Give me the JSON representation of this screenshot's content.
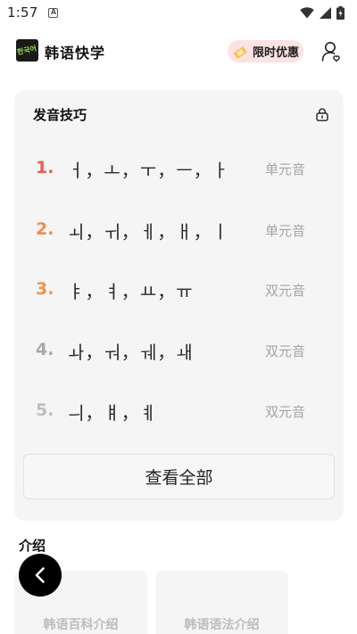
{
  "status_bar": {
    "time": "1:57",
    "app_icon_letter": "A"
  },
  "header": {
    "logo_text": "한국어",
    "app_title": "韩语快学",
    "promo_label": "限时优惠"
  },
  "pronunciation_card": {
    "title": "发音技巧",
    "rows": [
      {
        "number": "1.",
        "letters": "ㅓ，ㅗ，ㅜ，ㅡ，ㅏ",
        "tag": "单元音",
        "number_color": "#ee5a52"
      },
      {
        "number": "2.",
        "letters": "ㅚ，ㅟ，ㅔ，ㅐ，ㅣ",
        "tag": "单元音",
        "number_color": "#f28a4c"
      },
      {
        "number": "3.",
        "letters": "ㅑ，ㅕ，ㅛ，ㅠ",
        "tag": "双元音",
        "number_color": "#f2924e"
      },
      {
        "number": "4.",
        "letters": "ㅘ，ㅝ，ㅞ，ㅙ",
        "tag": "双元音",
        "number_color": "#a8a8a8"
      },
      {
        "number": "5.",
        "letters": "ㅢ，ㅒ，ㅖ",
        "tag": "双元音",
        "number_color": "#bdbdbd"
      }
    ],
    "view_all_label": "查看全部"
  },
  "intro": {
    "title": "介绍",
    "cards": [
      "韩语百科介绍",
      "韩语语法介绍"
    ]
  },
  "icons": {
    "lock": "lock-icon",
    "user": "user-icon",
    "back": "chevron-left-icon"
  }
}
